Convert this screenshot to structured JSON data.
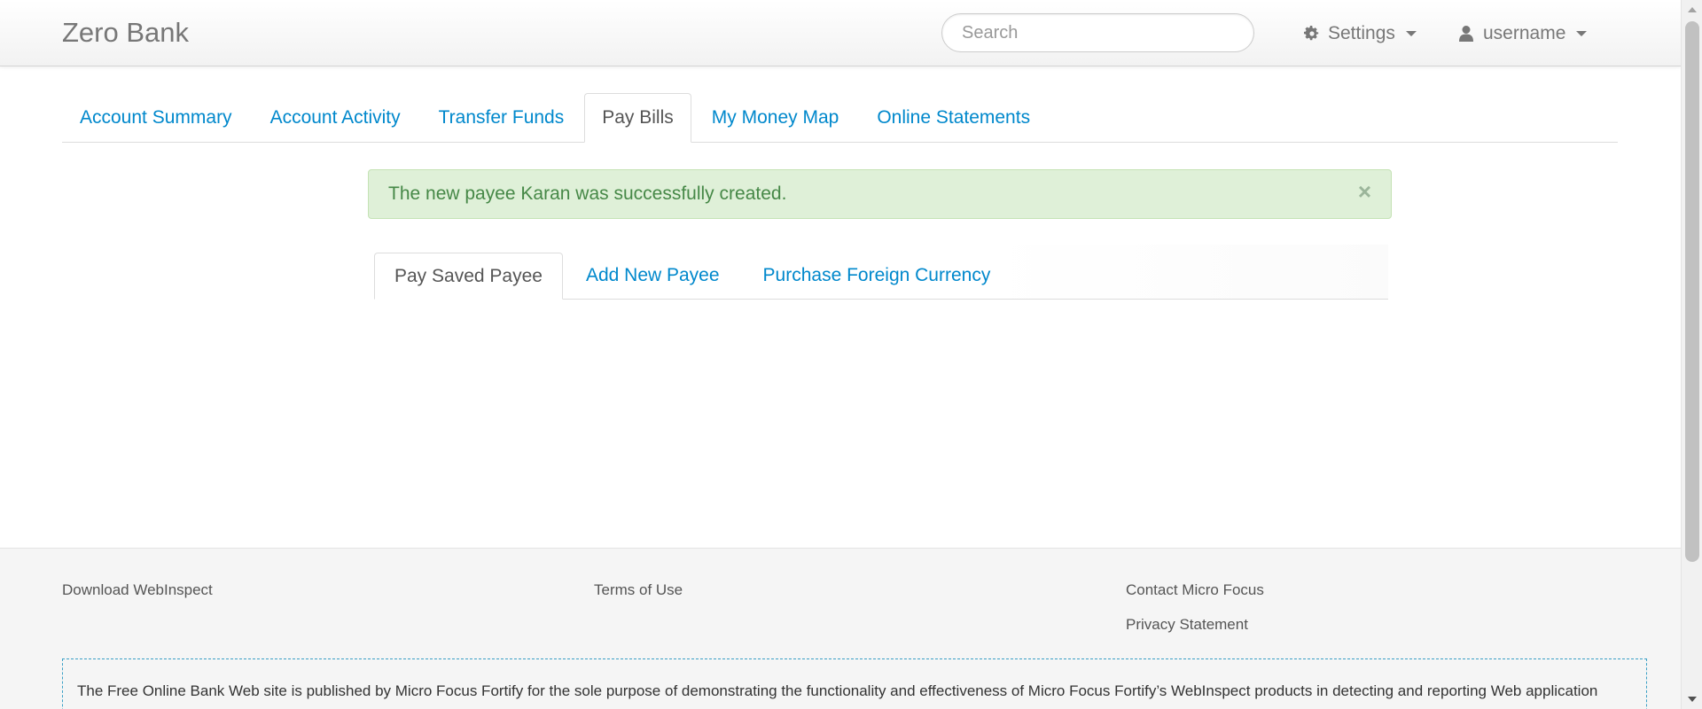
{
  "navbar": {
    "brand": "Zero Bank",
    "search_placeholder": "Search",
    "settings_label": "Settings",
    "user_label": "username",
    "settings_icon": "gear-icon",
    "user_icon": "user-icon"
  },
  "main_tabs": [
    {
      "label": "Account Summary",
      "active": false
    },
    {
      "label": "Account Activity",
      "active": false
    },
    {
      "label": "Transfer Funds",
      "active": false
    },
    {
      "label": "Pay Bills",
      "active": true
    },
    {
      "label": "My Money Map",
      "active": false
    },
    {
      "label": "Online Statements",
      "active": false
    }
  ],
  "alert": {
    "message": "The new payee Karan was successfully created.",
    "close_symbol": "×"
  },
  "sub_tabs": [
    {
      "label": "Pay Saved Payee",
      "active": true
    },
    {
      "label": "Add New Payee",
      "active": false
    },
    {
      "label": "Purchase Foreign Currency",
      "active": false
    }
  ],
  "footer": {
    "download": "Download WebInspect",
    "terms": "Terms of Use",
    "contact": "Contact Micro Focus",
    "privacy": "Privacy Statement",
    "disclaimer": "The Free Online Bank Web site is published by Micro Focus Fortify for the sole purpose of demonstrating the functionality and effectiveness of Micro Focus Fortify’s WebInspect products in detecting and reporting Web application"
  },
  "colors": {
    "link": "#0088cc",
    "alert_bg": "#dff0d8",
    "alert_text": "#468847",
    "footer_bg": "#f5f5f5"
  }
}
